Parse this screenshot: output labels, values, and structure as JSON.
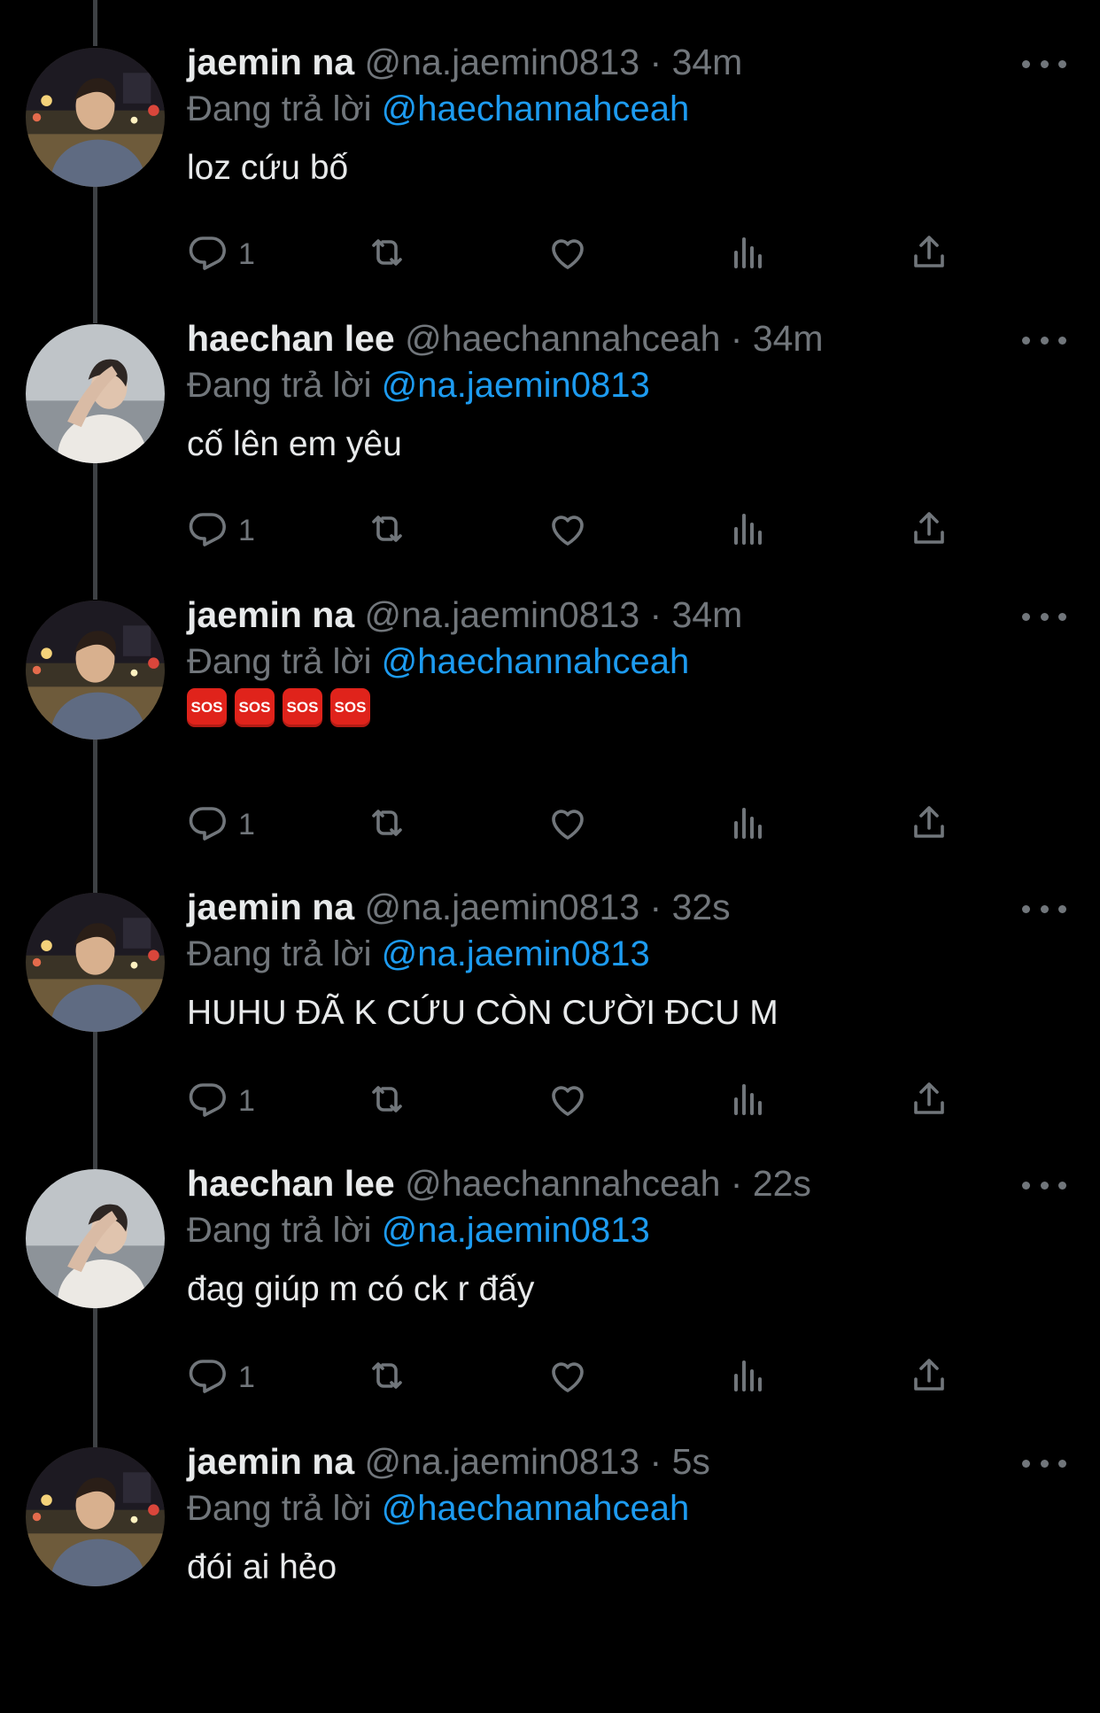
{
  "tweets": [
    {
      "name": "jaemin na",
      "handle": "@na.jaemin0813",
      "sep": " · ",
      "time": "34m",
      "reply_prefix": "Đang trả lời ",
      "reply_to": "@haechannahceah",
      "text": "loz cứu bố",
      "sos": [],
      "reply_count": "1",
      "avatar": "jaemin"
    },
    {
      "name": "haechan lee",
      "handle": "@haechannahceah",
      "sep": " · ",
      "time": "34m",
      "reply_prefix": "Đang trả lời ",
      "reply_to": "@na.jaemin0813",
      "text": "cố lên em yêu",
      "sos": [],
      "reply_count": "1",
      "avatar": "haechan"
    },
    {
      "name": "jaemin na",
      "handle": "@na.jaemin0813",
      "sep": " · ",
      "time": "34m",
      "reply_prefix": "Đang trả lời ",
      "reply_to": "@haechannahceah",
      "text": "",
      "sos": [
        "SOS",
        "SOS",
        "SOS",
        "SOS"
      ],
      "reply_count": "1",
      "avatar": "jaemin"
    },
    {
      "name": "jaemin na",
      "handle": "@na.jaemin0813",
      "sep": " · ",
      "time": "32s",
      "reply_prefix": "Đang trả lời ",
      "reply_to": "@na.jaemin0813",
      "text": "HUHU ĐÃ K CỨU CÒN CƯỜI ĐCU M",
      "sos": [],
      "reply_count": "1",
      "avatar": "jaemin"
    },
    {
      "name": "haechan lee",
      "handle": "@haechannahceah",
      "sep": " · ",
      "time": "22s",
      "reply_prefix": "Đang trả lời ",
      "reply_to": "@na.jaemin0813",
      "text": "đag giúp m có ck r đấy",
      "sos": [],
      "reply_count": "1",
      "avatar": "haechan"
    },
    {
      "name": "jaemin na",
      "handle": "@na.jaemin0813",
      "sep": " · ",
      "time": "5s",
      "reply_prefix": "Đang trả lời ",
      "reply_to": "@haechannahceah",
      "text": "đói ai hẻo",
      "sos": [],
      "reply_count": "",
      "avatar": "jaemin"
    }
  ],
  "colors": {
    "background": "#000000",
    "text": "#e7e9ea",
    "muted": "#71767b",
    "mention": "#1d9bf0",
    "sos": "#e0231b"
  },
  "icons": [
    "reply-icon",
    "retweet-icon",
    "like-icon",
    "views-icon",
    "share-icon",
    "more-icon"
  ]
}
